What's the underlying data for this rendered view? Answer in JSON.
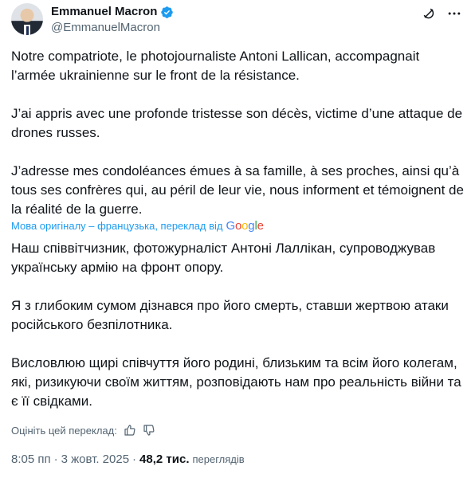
{
  "author": {
    "display_name": "Emmanuel Macron",
    "handle": "@EmmanuelMacron"
  },
  "original": {
    "paragraphs": [
      "Notre compatriote, le photojournaliste Antoni Lallican, accompagnait l’armée ukrainienne sur le front de la résistance.",
      "J’ai appris avec une profonde tristesse son décès, victime d’une attaque de drones russes.",
      "J’adresse mes condoléances émues à sa famille, à ses proches, ainsi qu’à tous ses confrères qui, au péril de leur vie, nous informent et témoignent de la réalité de la guerre."
    ]
  },
  "translation": {
    "note": "Мова оригіналу – французька, переклад від",
    "provider": "Google",
    "paragraphs": [
      "Наш співвітчизник, фотожурналіст Антоні Лаллікан, супроводжував українську армію на фронт опору.",
      "Я з глибоким сумом дізнався про його смерть, ставши жертвою атаки російського безпілотника.",
      "Висловлюю щирі співчуття його родині, близьким та всім його колегам, які, ризикуючи своїм життям, розповідають нам про реальність війни та є її свідками."
    ],
    "rate_label": "Оцініть цей переклад:"
  },
  "meta": {
    "time": "8:05 пп",
    "separator": "·",
    "date": "3 жовт. 2025",
    "views_count": "48,2 тис.",
    "views_label": "переглядів"
  },
  "icons": {
    "verified": "verified-badge-icon",
    "grok": "grok-icon",
    "more": "more-icon",
    "thumb_up": "thumb-up-icon",
    "thumb_down": "thumb-down-icon"
  },
  "colors": {
    "text": "#0f1419",
    "secondary": "#536471",
    "link": "#1d9bf0",
    "verified": "#1d9bf0"
  }
}
